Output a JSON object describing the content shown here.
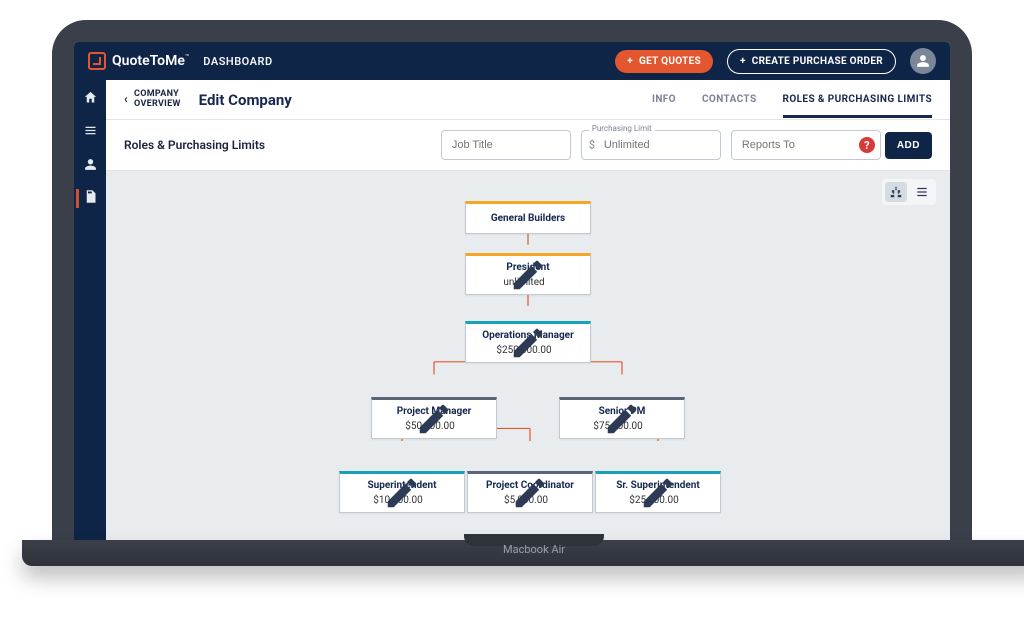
{
  "brand": {
    "name": "QuoteToMe",
    "tm": "™"
  },
  "nav": {
    "dashboard_label": "DASHBOARD",
    "get_quotes_label": "GET QUOTES",
    "create_po_label": "CREATE PURCHASE ORDER"
  },
  "breadcrumb": {
    "back_line1": "COMPANY",
    "back_line2": "OVERVIEW"
  },
  "page": {
    "title": "Edit Company"
  },
  "tabs": {
    "info": "INFO",
    "contacts": "CONTACTS",
    "roles": "ROLES & PURCHASING LIMITS"
  },
  "filter": {
    "section_label": "Roles & Purchasing Limits",
    "job_title_placeholder": "Job Title",
    "limit_float_label": "Purchasing Limit",
    "limit_placeholder": "Unlimited",
    "reports_to_placeholder": "Reports To",
    "add_label": "ADD"
  },
  "chart": {
    "root": {
      "title": "General Builders"
    },
    "president": {
      "title": "President",
      "amount": "unlimited"
    },
    "ops": {
      "title": "Operations Manager",
      "amount": "$250,000.00"
    },
    "pm": {
      "title": "Project Manager",
      "amount": "$50,000.00"
    },
    "spm": {
      "title": "Senior PM",
      "amount": "$75,000.00"
    },
    "super": {
      "title": "Superintendent",
      "amount": "$10,000.00"
    },
    "pc": {
      "title": "Project Coordinator",
      "amount": "$5,000.00"
    },
    "srsuper": {
      "title": "Sr. Superintendent",
      "amount": "$25,000.00"
    }
  },
  "laptop_caption": "Macbook Air"
}
